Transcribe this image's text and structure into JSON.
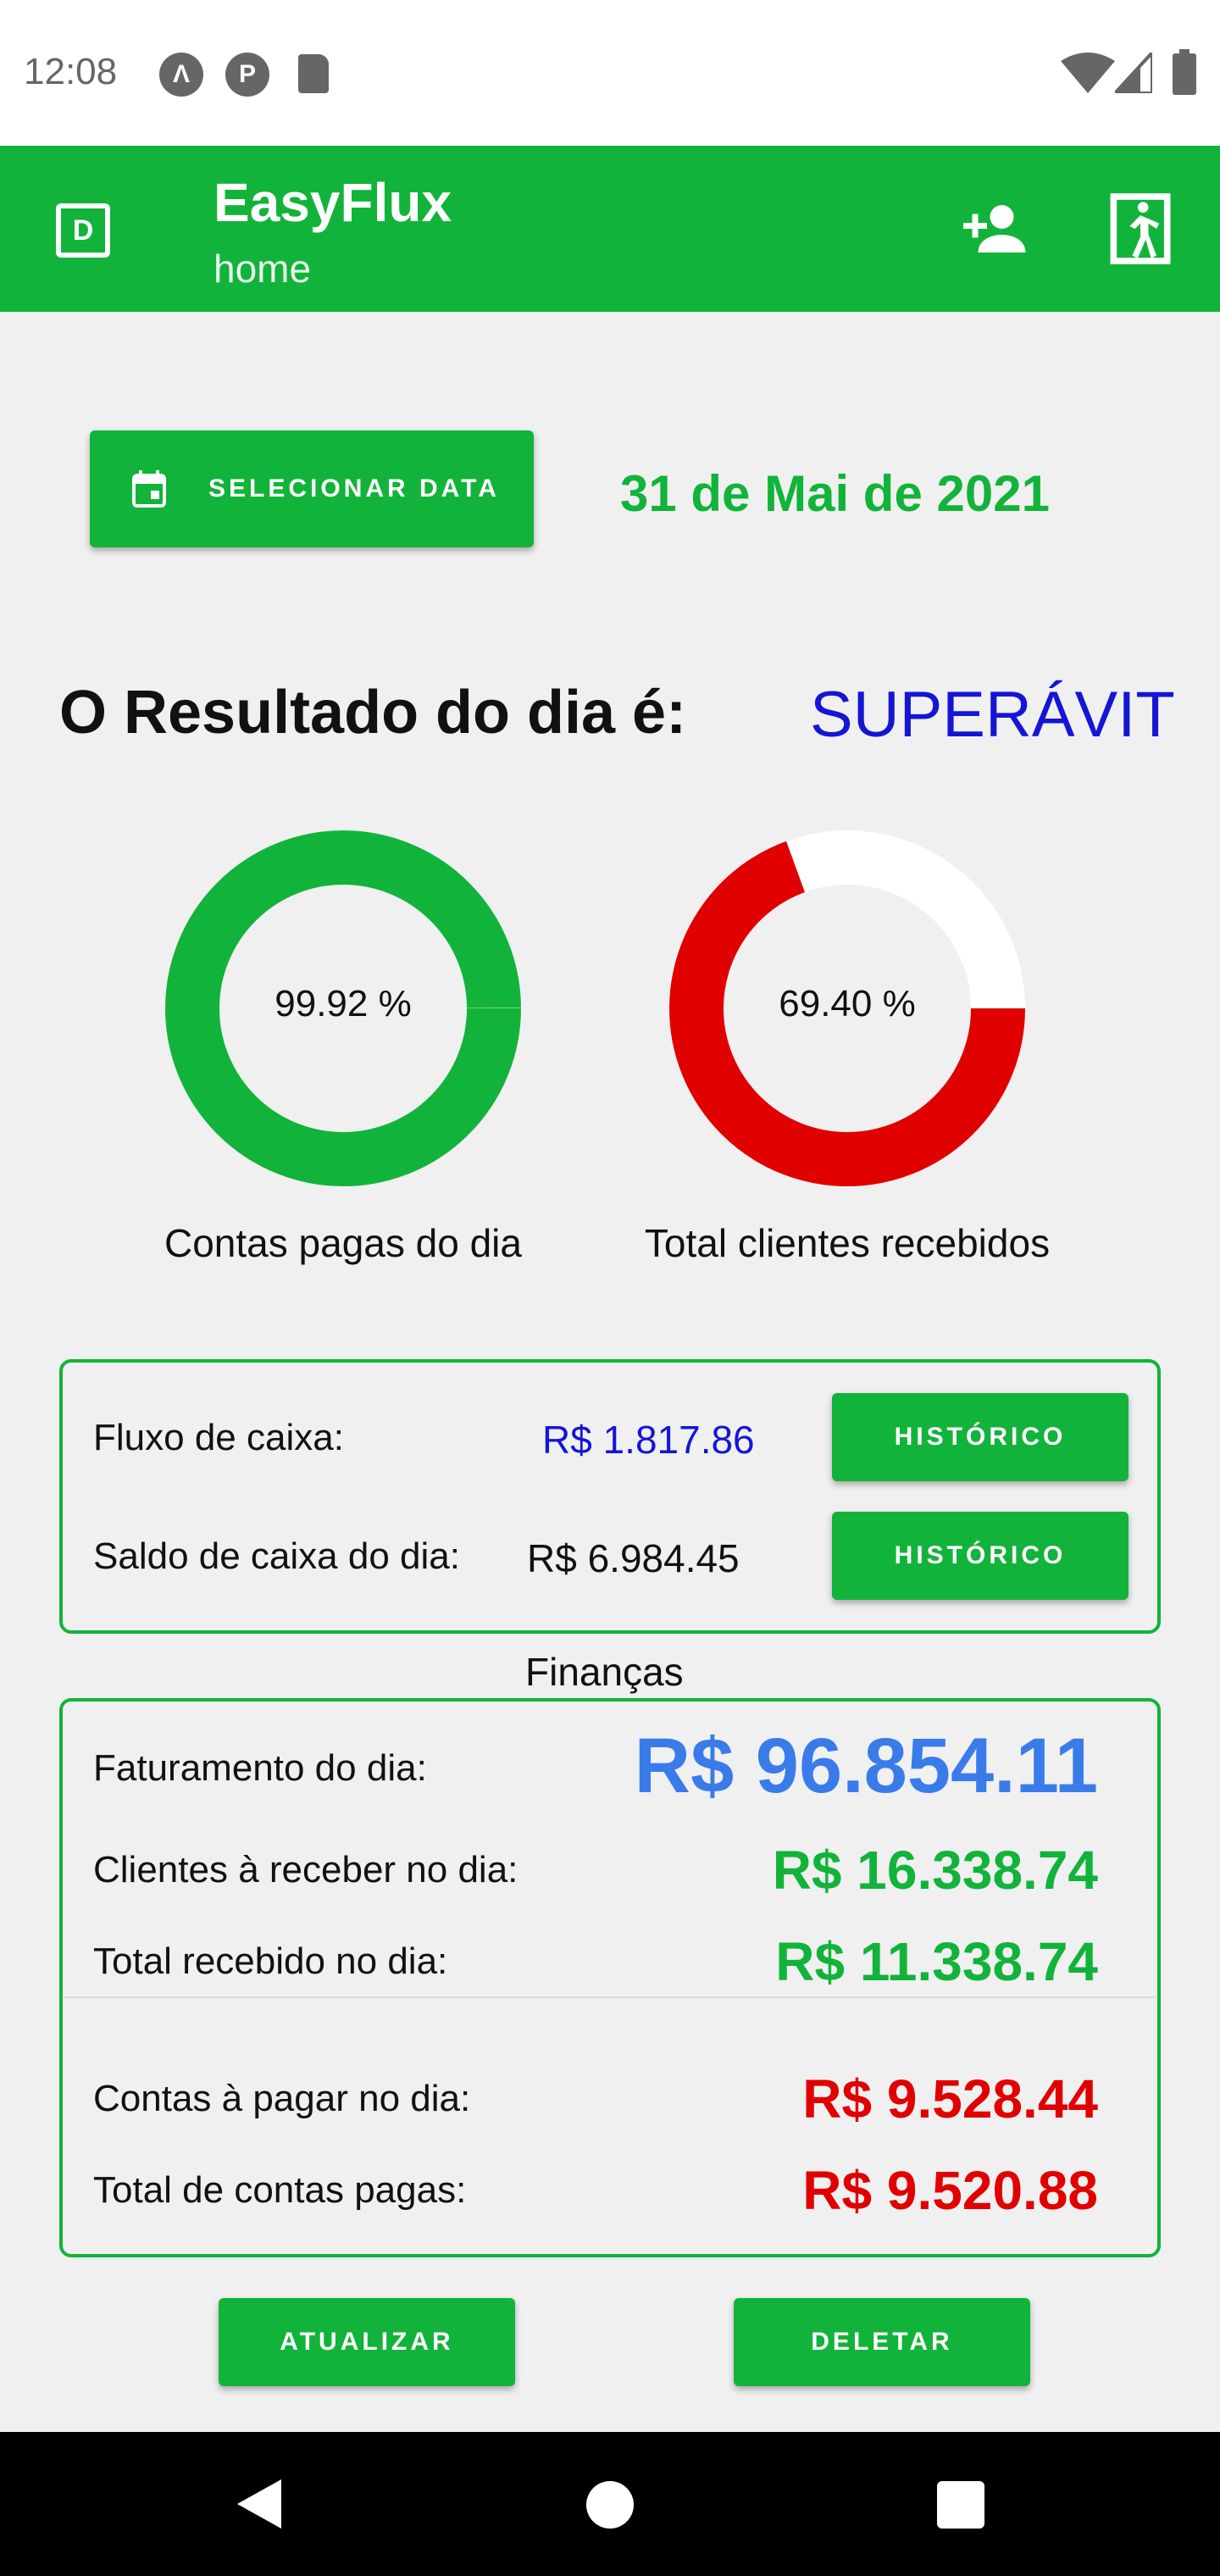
{
  "status_bar": {
    "time": "12:08",
    "icons": [
      "app-a-icon",
      "app-p-icon",
      "sd-card-icon",
      "wifi-icon",
      "signal-icon",
      "battery-icon"
    ]
  },
  "app_bar": {
    "drawer_icon_letter": "D",
    "title": "EasyFlux",
    "subtitle": "home",
    "actions": [
      "add-user-icon",
      "exit-icon"
    ]
  },
  "date_row": {
    "button_label": "SELECIONAR DATA",
    "date_text": "31 de Mai de 2021"
  },
  "result": {
    "label": "O Resultado do dia é:",
    "value": "SUPERÁVIT"
  },
  "donuts": [
    {
      "percent_text": "99.92 %",
      "fraction": 0.9992,
      "caption": "Contas pagas do dia",
      "color": "#12b33a",
      "track_color": "#ffffff"
    },
    {
      "percent_text": "69.40 %",
      "fraction": 0.694,
      "caption": "Total clientes recebidos",
      "color": "#e00000",
      "track_color": "#ffffff"
    }
  ],
  "cash": {
    "fluxo_label": "Fluxo de caixa:",
    "fluxo_value": "R$ 1.817.86",
    "saldo_label": "Saldo de caixa do dia:",
    "saldo_value": "R$ 6.984.45",
    "history_label": "HISTÓRICO"
  },
  "finance": {
    "title": "Finanças",
    "faturamento_label": "Faturamento do dia:",
    "faturamento_value": "R$ 96.854.11",
    "clientes_label": "Clientes à receber no dia:",
    "clientes_value": "R$ 16.338.74",
    "recebido_label": "Total recebido no dia:",
    "recebido_value": "R$ 11.338.74",
    "pagar_label": "Contas à pagar no dia:",
    "pagar_value": "R$ 9.528.44",
    "pagas_label": "Total de contas pagas:",
    "pagas_value": "R$ 9.520.88"
  },
  "actions": {
    "update_label": "ATUALIZAR",
    "delete_label": "DELETAR"
  },
  "colors": {
    "primary": "#12b33a",
    "blue": "#1515d6",
    "red": "#e00000",
    "accent_blue": "#3a7bea"
  }
}
